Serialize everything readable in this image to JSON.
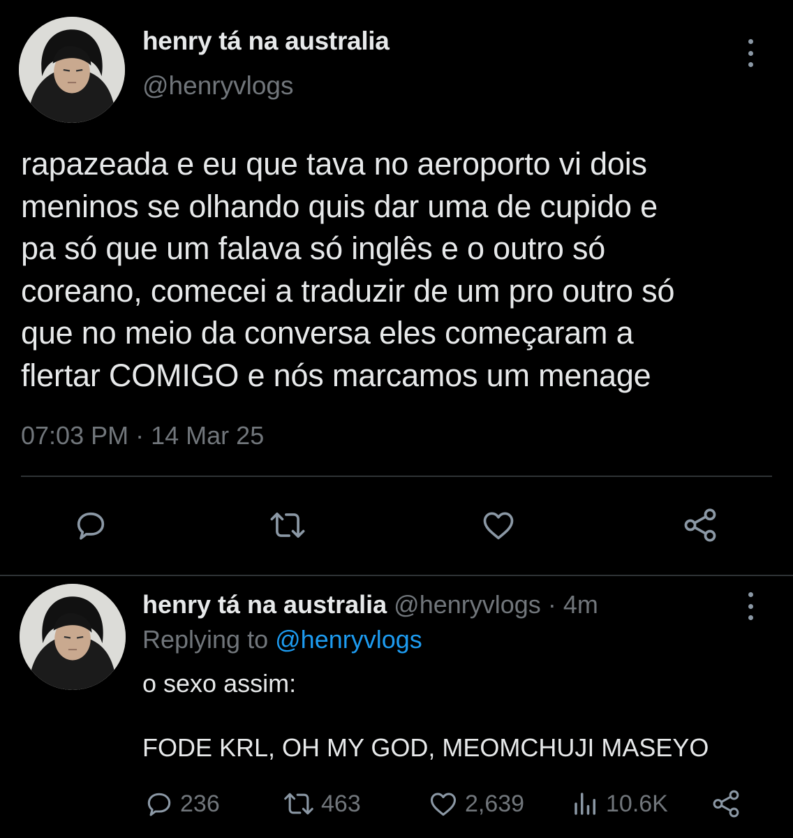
{
  "main_tweet": {
    "display_name": "henry tá na australia",
    "handle": "@henryvlogs",
    "text_lines": [
      "rapazeada e eu que tava no aeroporto vi dois",
      "meninos se olhando quis dar uma de cupido e",
      "pa só que um falava só inglês e o outro só",
      "coreano, comecei a traduzir de um pro outro só",
      "que no meio da conversa eles começaram a",
      "flertar COMIGO e nós marcamos um menage"
    ],
    "time": "07:03 PM",
    "separator": "·",
    "date": "14 Mar 25"
  },
  "reply": {
    "display_name": "henry tá na australia",
    "handle": "@henryvlogs",
    "separator": "·",
    "time": "4m",
    "replying_prefix": "Replying to",
    "replying_mention": "@henryvlogs",
    "text_line_1": "o sexo assim:",
    "text_line_2": "FODE KRL, OH MY GOD, MEOMCHUJI MASEYO",
    "stats": {
      "replies": "236",
      "retweets": "463",
      "likes": "2,639",
      "views": "10.6K"
    }
  },
  "colors": {
    "background": "#000000",
    "text_primary": "#e7e9ea",
    "text_secondary": "#71767b",
    "accent_link": "#1d9bf0",
    "icon": "#8b98a5",
    "divider": "#2f3336"
  },
  "icons": [
    "more-vertical-icon",
    "reply-icon",
    "retweet-icon",
    "like-icon",
    "share-icon",
    "views-icon"
  ]
}
